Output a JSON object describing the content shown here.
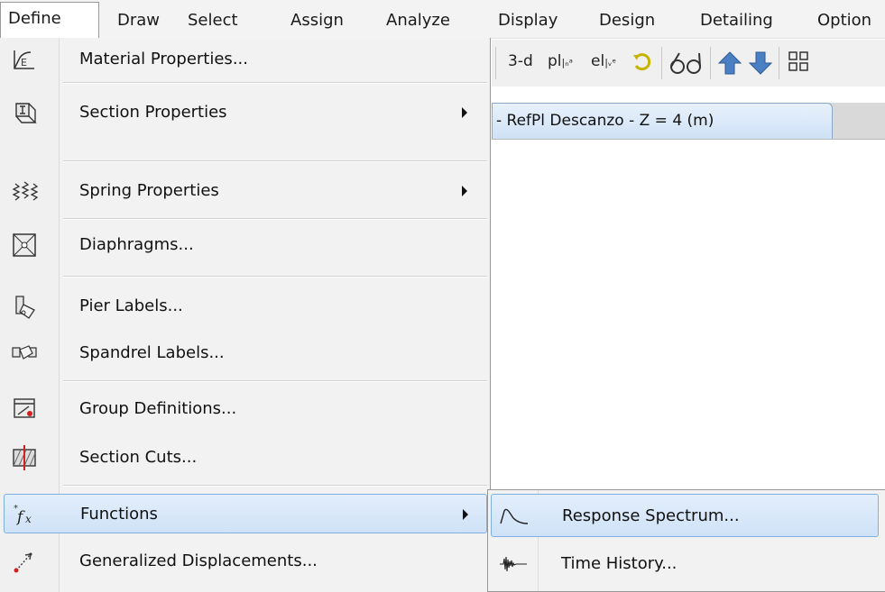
{
  "menubar": {
    "items": [
      "Define",
      "Draw",
      "Select",
      "Assign",
      "Analyze",
      "Display",
      "Design",
      "Detailing",
      "Option"
    ]
  },
  "toolbar": {
    "view_3d": "3-d",
    "plan": "pl",
    "elev": "el"
  },
  "window_tab": {
    "title": "- RefPl Descanzo - Z = 4 (m)"
  },
  "define_menu": {
    "items": [
      {
        "label": "Material Properties...",
        "icon": "material-properties-icon",
        "has_submenu": false
      },
      {
        "label": "Section Properties",
        "icon": "section-properties-icon",
        "has_submenu": true
      },
      {
        "label": "Spring Properties",
        "icon": "spring-properties-icon",
        "has_submenu": true
      },
      {
        "label": "Diaphragms...",
        "icon": "diaphragms-icon",
        "has_submenu": false
      },
      {
        "label": "Pier Labels...",
        "icon": "pier-labels-icon",
        "has_submenu": false
      },
      {
        "label": "Spandrel Labels...",
        "icon": "spandrel-labels-icon",
        "has_submenu": false
      },
      {
        "label": "Group Definitions...",
        "icon": "group-definitions-icon",
        "has_submenu": false
      },
      {
        "label": "Section Cuts...",
        "icon": "section-cuts-icon",
        "has_submenu": false
      },
      {
        "label": "Functions",
        "icon": "functions-icon",
        "has_submenu": true
      },
      {
        "label": "Generalized Displacements...",
        "icon": "generalized-displacements-icon",
        "has_submenu": false
      }
    ]
  },
  "functions_submenu": {
    "items": [
      {
        "label": "Response Spectrum...",
        "icon": "response-spectrum-icon"
      },
      {
        "label": "Time History...",
        "icon": "time-history-icon"
      }
    ]
  },
  "colors": {
    "highlight_border": "#7fb0e3",
    "highlight_fill": "#d8e8f9",
    "menu_bg": "#f2f2f2"
  }
}
